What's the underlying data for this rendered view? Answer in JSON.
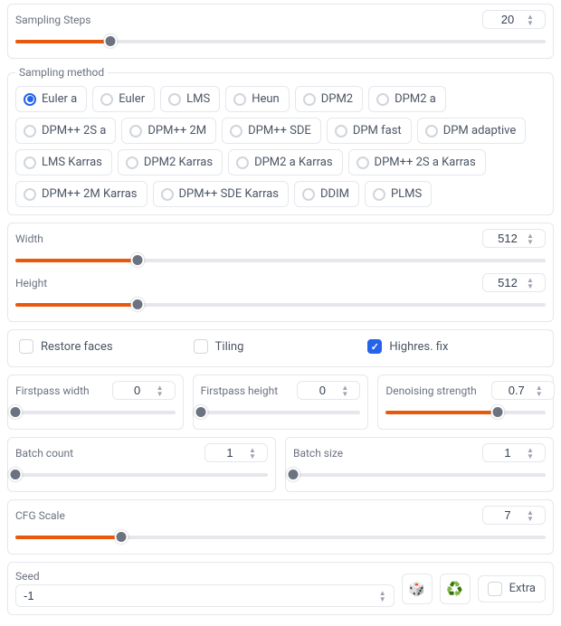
{
  "sampling_steps": {
    "label": "Sampling Steps",
    "value": "20",
    "pct": 18
  },
  "sampling_method": {
    "legend": "Sampling method",
    "selected": 0,
    "options": [
      "Euler a",
      "Euler",
      "LMS",
      "Heun",
      "DPM2",
      "DPM2 a",
      "DPM++ 2S a",
      "DPM++ 2M",
      "DPM++ SDE",
      "DPM fast",
      "DPM adaptive",
      "LMS Karras",
      "DPM2 Karras",
      "DPM2 a Karras",
      "DPM++ 2S a Karras",
      "DPM++ 2M Karras",
      "DPM++ SDE Karras",
      "DDIM",
      "PLMS"
    ]
  },
  "width": {
    "label": "Width",
    "value": "512",
    "pct": 23
  },
  "height": {
    "label": "Height",
    "value": "512",
    "pct": 23
  },
  "checks": {
    "restore_faces": {
      "label": "Restore faces",
      "checked": false
    },
    "tiling": {
      "label": "Tiling",
      "checked": false
    },
    "highres_fix": {
      "label": "Highres. fix",
      "checked": true
    }
  },
  "firstpass_width": {
    "label": "Firstpass width",
    "value": "0",
    "pct": 0
  },
  "firstpass_height": {
    "label": "Firstpass height",
    "value": "0",
    "pct": 0
  },
  "denoising": {
    "label": "Denoising strength",
    "value": "0.7",
    "pct": 70
  },
  "batch_count": {
    "label": "Batch count",
    "value": "1",
    "pct": 0
  },
  "batch_size": {
    "label": "Batch size",
    "value": "1",
    "pct": 0
  },
  "cfg_scale": {
    "label": "CFG Scale",
    "value": "7",
    "pct": 20
  },
  "seed": {
    "label": "Seed",
    "value": "-1"
  },
  "icons": {
    "dice": "🎲",
    "recycle": "♻️"
  },
  "extra": {
    "label": "Extra",
    "checked": false
  }
}
